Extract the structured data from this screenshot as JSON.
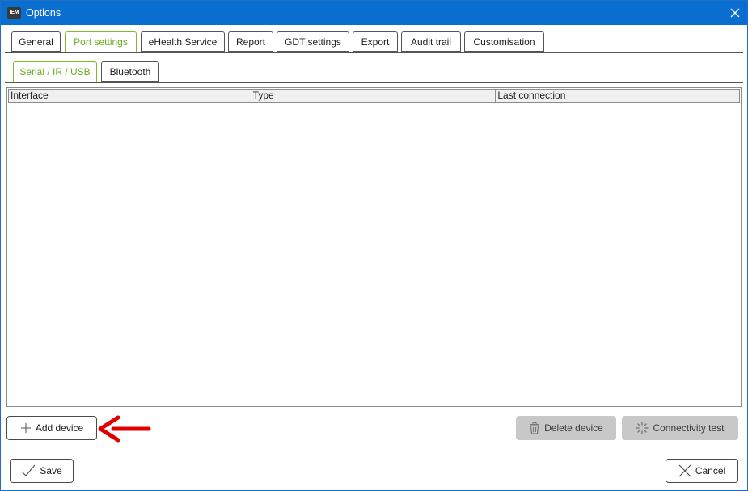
{
  "window": {
    "app_icon_text": "IEM",
    "title": "Options"
  },
  "tabs": [
    {
      "label": "General",
      "active": false
    },
    {
      "label": "Port settings",
      "active": true
    },
    {
      "label": "eHealth Service",
      "active": false
    },
    {
      "label": "Report",
      "active": false
    },
    {
      "label": "GDT settings",
      "active": false
    },
    {
      "label": "Export",
      "active": false
    },
    {
      "label": "Audit trail",
      "active": false
    },
    {
      "label": "Customisation",
      "active": false
    }
  ],
  "subtabs": [
    {
      "label": "Serial / IR / USB",
      "active": true
    },
    {
      "label": "Bluetooth",
      "active": false
    }
  ],
  "table": {
    "columns": [
      "Interface",
      "Type",
      "Last connection"
    ],
    "rows": []
  },
  "buttons": {
    "add_device": "Add device",
    "delete_device": "Delete device",
    "connectivity_test": "Connectivity test",
    "save": "Save",
    "cancel": "Cancel"
  },
  "colors": {
    "titlebar": "#0a6ed1",
    "active_tab": "#6cab1f",
    "annotation_arrow": "#e00000",
    "disabled_button": "#c8c8c8"
  }
}
